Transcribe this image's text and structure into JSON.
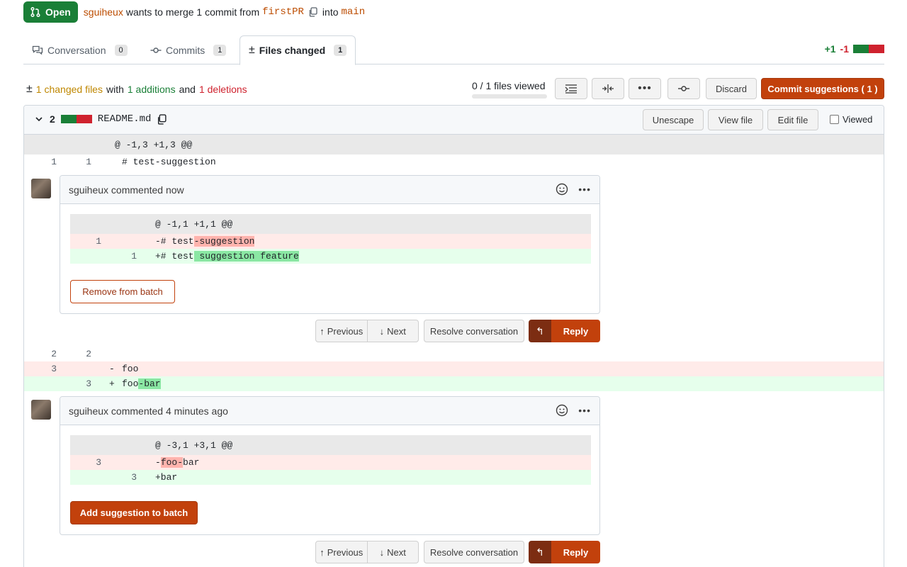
{
  "pr": {
    "state": "Open",
    "author": "sguiheux",
    "text_wants": "wants to merge 1 commit from",
    "head_branch": "firstPR",
    "text_into": "into",
    "base_branch": "main"
  },
  "tabs": [
    {
      "label": "Conversation",
      "count": "0"
    },
    {
      "label": "Commits",
      "count": "1"
    },
    {
      "label": "Files changed",
      "count": "1"
    }
  ],
  "diffstat": {
    "additions": "+1",
    "deletions": "-1"
  },
  "toolbar": {
    "changed_files": "1 changed files",
    "with": "with",
    "additions": "1 additions",
    "and": "and",
    "deletions": "1 deletions",
    "viewed_progress": "0 / 1 files viewed",
    "viewed_fraction": 0,
    "discard_label": "Discard",
    "commit_label": "Commit suggestions ( 1 )"
  },
  "file": {
    "change_count": "2",
    "name": "README.md",
    "unescape_label": "Unescape",
    "view_file_label": "View file",
    "edit_file_label": "Edit file",
    "viewed_label": "Viewed"
  },
  "diff": {
    "hunk1": "@ -1,3 +1,3 @@",
    "row1": {
      "old": "1",
      "new": "1",
      "code": "# test-suggestion"
    },
    "row2": {
      "old": "2",
      "new": "2",
      "code": ""
    },
    "row3": {
      "old": "3",
      "sign": "-",
      "code": "foo"
    },
    "row4": {
      "new": "3",
      "sign": "+",
      "code_pre": "foo",
      "code_hl": "-bar"
    }
  },
  "comments": [
    {
      "author": "sguiheux",
      "header": "sguiheux commented now",
      "hunk": "@ -1,1 +1,1 @@",
      "del_line": "1",
      "del_pre": "-# test",
      "del_hl": "-suggestion",
      "add_line": "1",
      "add_pre": "+# test",
      "add_hl": " suggestion feature",
      "button": "Remove from batch"
    },
    {
      "author": "sguiheux",
      "header": "sguiheux commented 4 minutes ago",
      "hunk": "@ -3,1 +3,1 @@",
      "del_line": "3",
      "del_pre": "-",
      "del_hl": "foo-",
      "del_post": "bar",
      "add_line": "3",
      "add_pre": "+bar",
      "button": "Add suggestion to batch"
    }
  ],
  "thread_actions": {
    "previous": "Previous",
    "next": "Next",
    "resolve": "Resolve conversation",
    "reply": "Reply"
  },
  "colors": {
    "open_green": "#1a7f37",
    "accent_orange": "#c2410c",
    "del_bg": "#ffebe9",
    "add_bg": "#e6ffec"
  }
}
